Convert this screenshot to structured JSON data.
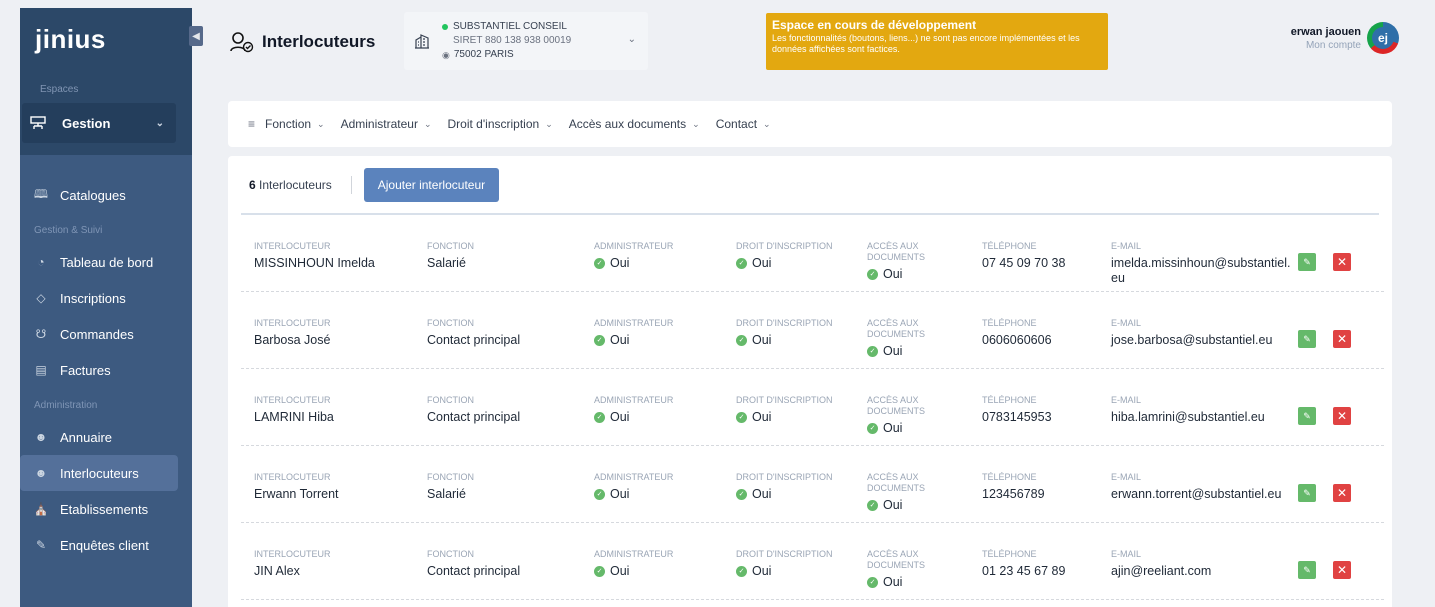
{
  "sidebar": {
    "logo": "jinius",
    "spaces_label": "Espaces",
    "space": "Gestion",
    "item_catalogues": "Catalogues",
    "group_suivi": "Gestion & Suivi",
    "item_tableau": "Tableau de bord",
    "item_inscriptions": "Inscriptions",
    "item_commandes": "Commandes",
    "item_factures": "Factures",
    "group_admin": "Administration",
    "item_annuaire": "Annuaire",
    "item_interlocuteurs": "Interlocuteurs",
    "item_etablissements": "Etablissements",
    "item_enquetes": "Enquêtes client"
  },
  "header": {
    "title": "Interlocuteurs",
    "company_name": "SUBSTANTIEL CONSEIL",
    "company_siret": "SIRET 880 138 938 00019",
    "company_address": "75002 PARIS",
    "banner_title": "Espace en cours de développement",
    "banner_desc": "Les fonctionnalités (boutons, liens...) ne sont pas encore implémentées et les données affichées sont factices.",
    "user_name": "erwan jaouen",
    "user_link": "Mon compte",
    "avatar_initials": "ej"
  },
  "filters": [
    "Fonction",
    "Administrateur",
    "Droit d'inscription",
    "Accès aux documents",
    "Contact"
  ],
  "list": {
    "count": "6",
    "count_label": "Interlocuteurs",
    "add_button": "Ajouter interlocuteur",
    "labels": {
      "interlocuteur": "INTERLOCUTEUR",
      "fonction": "FONCTION",
      "administrateur": "ADMINISTRATEUR",
      "droit": "DROIT D'INSCRIPTION",
      "acces": "ACCÈS AUX DOCUMENTS",
      "telephone": "TÉLÉPHONE",
      "email": "E-MAIL"
    },
    "rows": [
      {
        "name": "MISSINHOUN Imelda",
        "fonction": "Salarié",
        "admin": "Oui",
        "droit": "Oui",
        "acces": "Oui",
        "tel": "07 45 09 70 38",
        "email": "imelda.missinhoun@substantiel.eu"
      },
      {
        "name": "Barbosa José",
        "fonction": "Contact principal",
        "admin": "Oui",
        "droit": "Oui",
        "acces": "Oui",
        "tel": "0606060606",
        "email": "jose.barbosa@substantiel.eu"
      },
      {
        "name": "LAMRINI Hiba",
        "fonction": "Contact principal",
        "admin": "Oui",
        "droit": "Oui",
        "acces": "Oui",
        "tel": "0783145953",
        "email": "hiba.lamrini@substantiel.eu"
      },
      {
        "name": "Erwann Torrent",
        "fonction": "Salarié",
        "admin": "Oui",
        "droit": "Oui",
        "acces": "Oui",
        "tel": "123456789",
        "email": "erwann.torrent@substantiel.eu"
      },
      {
        "name": "JIN Alex",
        "fonction": "Contact principal",
        "admin": "Oui",
        "droit": "Oui",
        "acces": "Oui",
        "tel": "01 23 45 67 89",
        "email": "ajin@reeliant.com"
      }
    ]
  }
}
